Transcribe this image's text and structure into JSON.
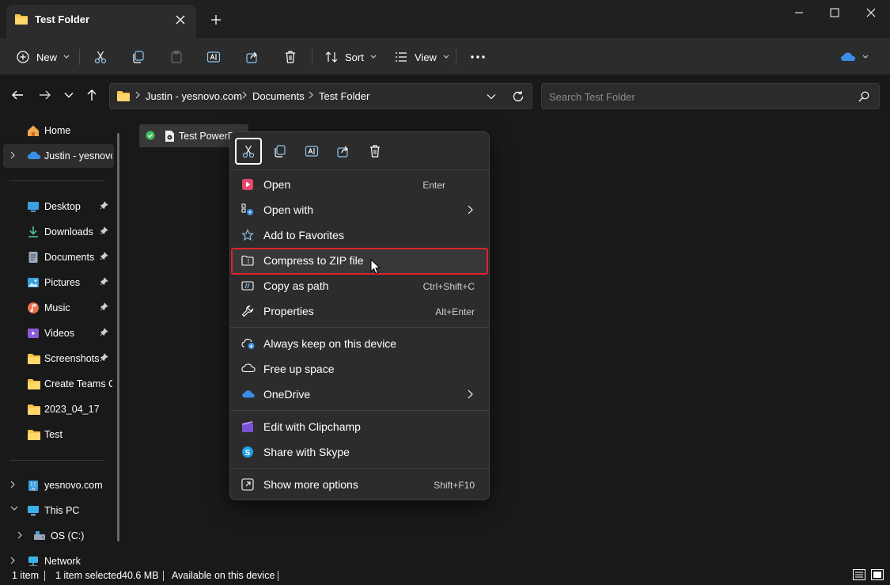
{
  "window": {
    "tab_title": "Test Folder",
    "controls": [
      "minimize",
      "maximize",
      "close"
    ]
  },
  "toolbar": {
    "new_label": "New",
    "sort_label": "Sort",
    "view_label": "View",
    "actions": [
      "cut",
      "copy",
      "paste",
      "rename",
      "share",
      "delete"
    ]
  },
  "address": {
    "breadcrumbs": [
      "Justin - yesnovo.com",
      "Documents",
      "Test Folder"
    ],
    "search_placeholder": "Search Test Folder"
  },
  "sidebar": {
    "top": [
      {
        "label": "Home",
        "icon": "home-icon"
      },
      {
        "label": "Justin - yesnovo",
        "icon": "onedrive-icon"
      }
    ],
    "quick_access": [
      {
        "label": "Desktop",
        "icon": "desktop-icon",
        "pinned": true
      },
      {
        "label": "Downloads",
        "icon": "download-icon",
        "pinned": true
      },
      {
        "label": "Documents",
        "icon": "document-icon",
        "pinned": true
      },
      {
        "label": "Pictures",
        "icon": "picture-icon",
        "pinned": true
      },
      {
        "label": "Music",
        "icon": "music-icon",
        "pinned": true
      },
      {
        "label": "Videos",
        "icon": "video-icon",
        "pinned": true
      },
      {
        "label": "Screenshots",
        "icon": "folder-icon",
        "pinned": true
      },
      {
        "label": "Create Teams Cl",
        "icon": "folder-icon",
        "pinned": false
      },
      {
        "label": "2023_04_17",
        "icon": "folder-icon",
        "pinned": false
      },
      {
        "label": "Test",
        "icon": "folder-icon",
        "pinned": false
      }
    ],
    "bottom": [
      {
        "label": "yesnovo.com",
        "icon": "building-icon"
      },
      {
        "label": "This PC",
        "icon": "pc-icon"
      },
      {
        "label": "OS (C:)",
        "icon": "drive-icon"
      },
      {
        "label": "Network",
        "icon": "network-icon"
      }
    ]
  },
  "files": [
    {
      "name": "Test PowerPoint",
      "status": "synced"
    }
  ],
  "context_menu": {
    "quick_actions": [
      "cut",
      "copy",
      "rename",
      "share",
      "delete"
    ],
    "items": [
      {
        "label": "Open",
        "shortcut": "Enter"
      },
      {
        "label": "Open with",
        "submenu": true
      },
      {
        "label": "Add to Favorites"
      },
      {
        "label": "Compress to ZIP file",
        "highlighted": true
      },
      {
        "label": "Copy as path",
        "shortcut": "Ctrl+Shift+C"
      },
      {
        "label": "Properties",
        "shortcut": "Alt+Enter"
      },
      {
        "label": "Always keep on this device"
      },
      {
        "label": "Free up space"
      },
      {
        "label": "OneDrive",
        "submenu": true
      },
      {
        "label": "Edit with Clipchamp"
      },
      {
        "label": "Share with Skype"
      },
      {
        "label": "Show more options",
        "shortcut": "Shift+F10"
      }
    ]
  },
  "status": {
    "count": "1 item",
    "selected": "1 item selected",
    "size": "40.6 MB",
    "availability": "Available on this device"
  },
  "colors": {
    "highlight_border": "#e0222a",
    "onedrive_blue": "#3a8ee6",
    "folder_yellow": "#f8c24a"
  }
}
